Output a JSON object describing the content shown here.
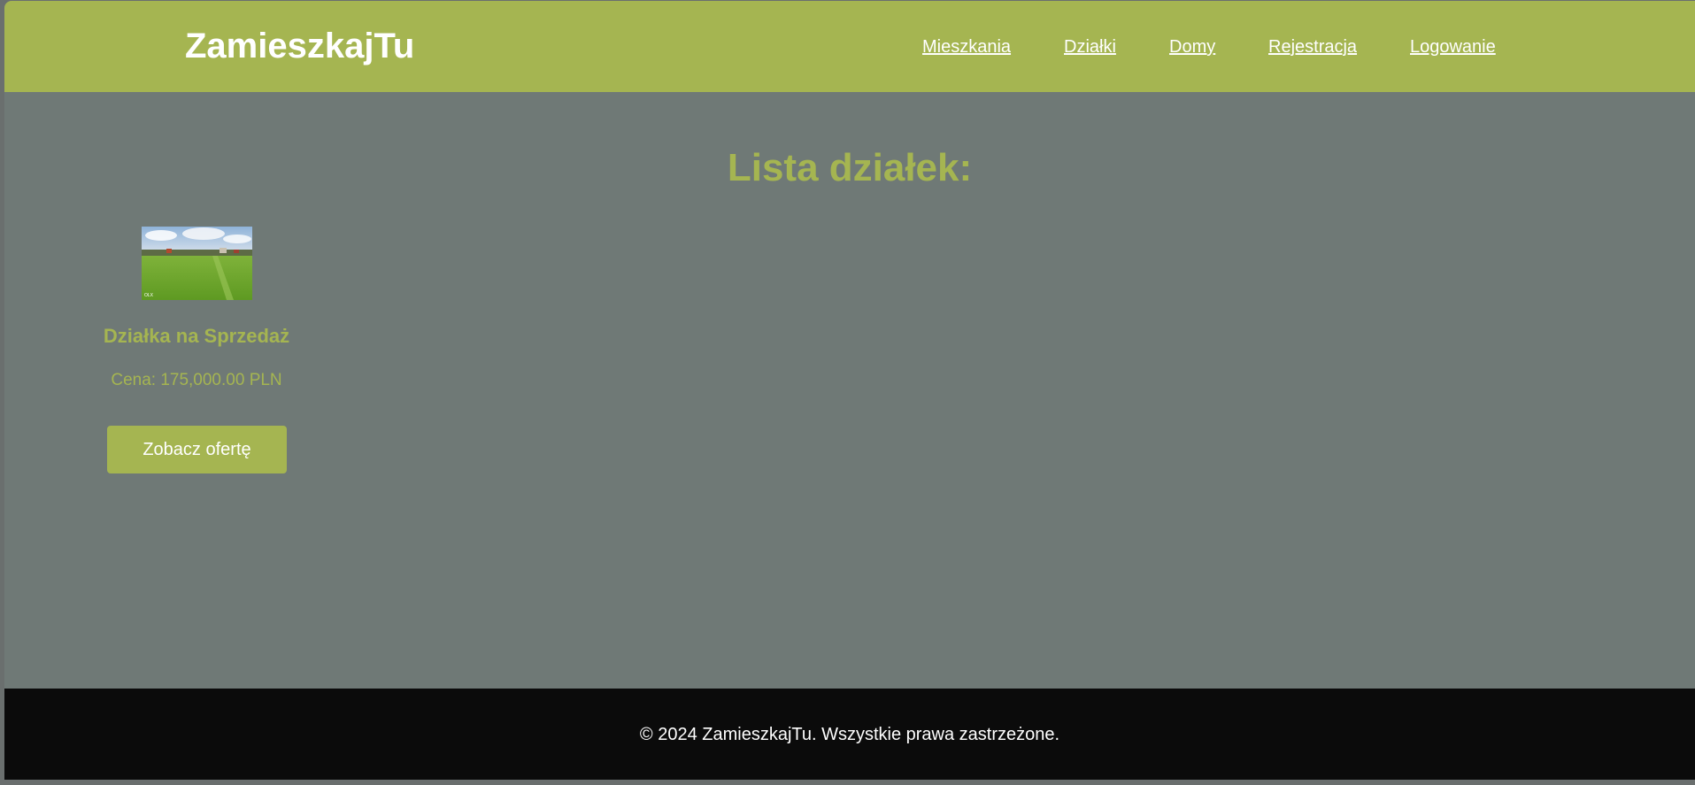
{
  "header": {
    "logo": "ZamieszkajTu",
    "nav": [
      {
        "label": "Mieszkania"
      },
      {
        "label": "Działki"
      },
      {
        "label": "Domy"
      },
      {
        "label": "Rejestracja"
      },
      {
        "label": "Logowanie"
      }
    ]
  },
  "main": {
    "title": "Lista działek:",
    "listings": [
      {
        "image": "land-plot-photo",
        "title": "Działka na Sprzedaż",
        "price": "Cena: 175,000.00 PLN",
        "button_label": "Zobacz ofertę"
      }
    ]
  },
  "footer": {
    "copyright": "© 2024 ZamieszkajTu. Wszystkie prawa zastrzeżone."
  },
  "colors": {
    "accent": "#a5b551",
    "background": "#6f7976",
    "footer": "#0b0b0b",
    "text_light": "#ffffff"
  }
}
